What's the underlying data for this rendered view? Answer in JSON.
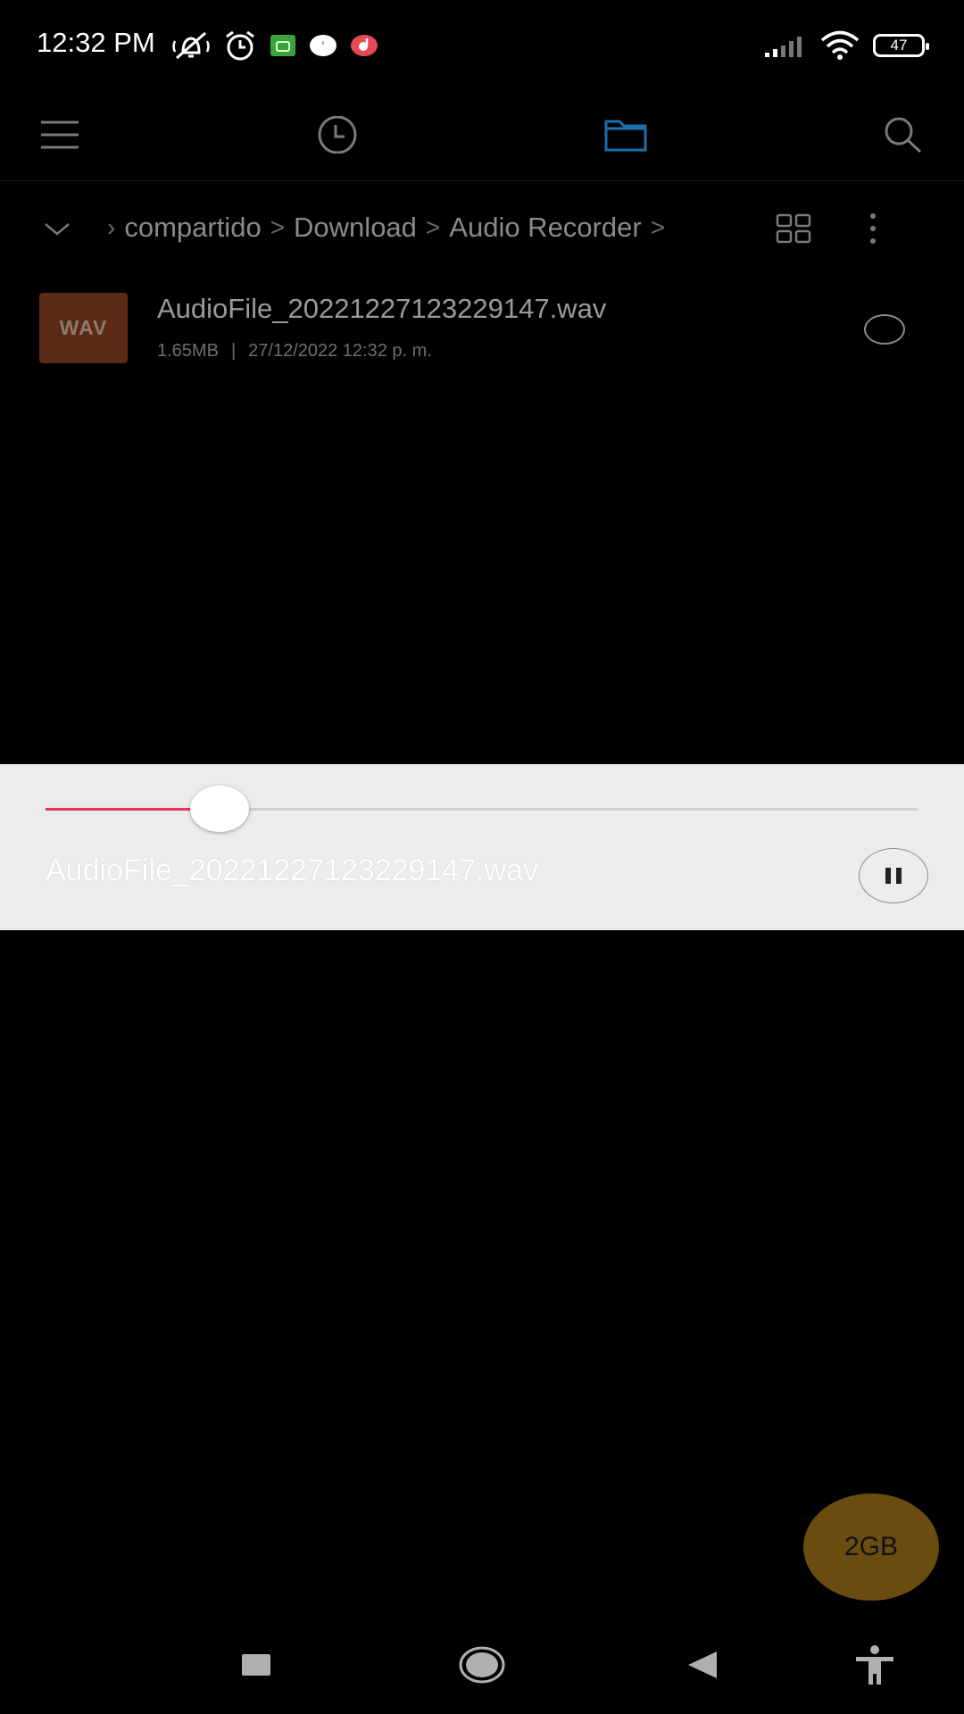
{
  "status_bar": {
    "time": "12:32 PM",
    "left_icons": [
      "muted-bell-icon",
      "alarm-icon",
      "android-app-icon",
      "white-circle-app-icon",
      "red-music-app-icon"
    ],
    "right_icons": [
      "signal-icon",
      "wifi-icon",
      "battery-icon"
    ],
    "battery": "47"
  },
  "topbar": {
    "tabs": [
      "menu-icon",
      "recent-icon",
      "folder-icon",
      "search-icon"
    ],
    "active_color": "#1a6fb0"
  },
  "breadcrumb": {
    "items": [
      "compartido",
      "Download",
      "Audio Recorder"
    ]
  },
  "files": [
    {
      "type_label": "WAV",
      "name": "AudioFile_20221227123229147.wav",
      "size": "1.65MB",
      "date": "27/12/2022 12:32 p. m."
    }
  ],
  "player": {
    "title": "AudioFile_20221227123229147.wav",
    "progress": 0.2,
    "accent": "#e8345a",
    "control": "pause-icon"
  },
  "storage": {
    "label": "2GB"
  },
  "navbar": {
    "buttons": [
      "recents-square-icon",
      "home-icon",
      "back-icon",
      "accessibility-icon"
    ]
  }
}
